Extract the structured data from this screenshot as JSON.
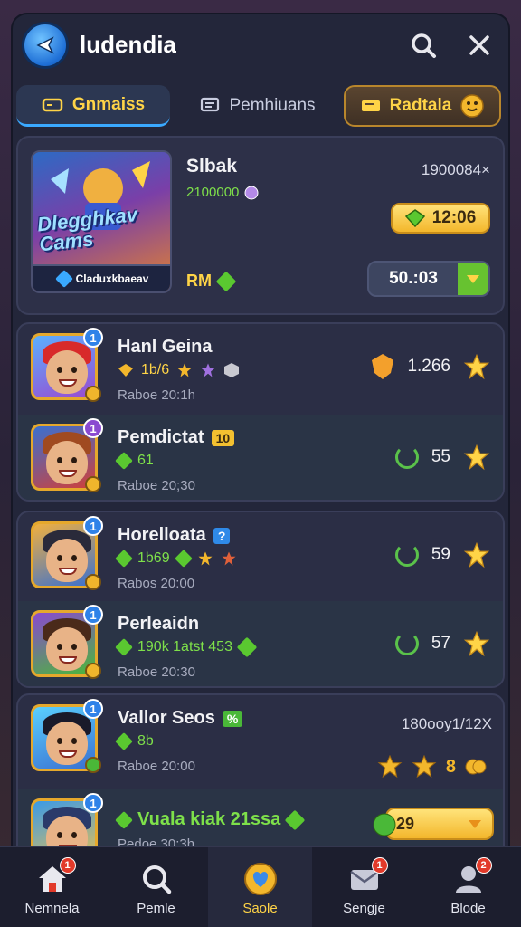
{
  "header": {
    "title": "ludendia"
  },
  "tabs": [
    {
      "label": "Gnmaiss"
    },
    {
      "label": "Pemhiuans"
    },
    {
      "label": "Radtala"
    }
  ],
  "featured": {
    "name": "Slbak",
    "sub": "2100000",
    "code": "1900084×",
    "time": "12:06",
    "logo_text": "Dlegghkav Cams",
    "ribbon": "Claduxkbaeav",
    "rm_label": "RM",
    "amount": "50.:03"
  },
  "rows": [
    {
      "name": "Hanl Geina",
      "stats": "1b/6",
      "time": "Raboe 20:1h",
      "value": "1.266",
      "badge": "1"
    },
    {
      "name": "Pemdictat",
      "tag": "10",
      "stats": "61",
      "time": "Raboe 20;30",
      "value": "55",
      "badge": "1"
    },
    {
      "name": "Horelloata",
      "tag": "?",
      "stats": "1b69",
      "time": "Rabos 20:00",
      "value": "59",
      "badge": "1"
    },
    {
      "name": "Perleaidn",
      "stats": "190k 1atst  453",
      "time": "Raboe 20:30",
      "value": "57",
      "badge": "1"
    },
    {
      "name": "Vallor Seos",
      "tag": "%",
      "stats": "8b",
      "time": "Raboe 20:00",
      "code": "180ooy1/12X",
      "value": "8",
      "badge": "1"
    },
    {
      "name": "Vuala kiak 21ssa",
      "time": "Pedoe 30:3h",
      "value": "29",
      "badge": "1"
    }
  ],
  "bottom_nav": [
    {
      "label": "Nemnela",
      "badge": "1"
    },
    {
      "label": "Pemle"
    },
    {
      "label": "Saole"
    },
    {
      "label": "Sengje",
      "badge": "1"
    },
    {
      "label": "Blode",
      "badge": "2"
    }
  ],
  "colors": {
    "accent": "#ffd447",
    "green": "#7ee04a",
    "panel": "#2d3048",
    "brand_blue": "#2f82e8"
  }
}
